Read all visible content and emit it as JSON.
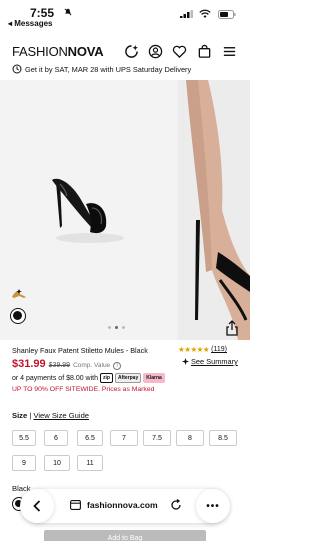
{
  "status_bar": {
    "time": "7:55",
    "back_app": "◂ Messages"
  },
  "header": {
    "logo_part1": "FASHION",
    "logo_part2": "NOVA",
    "icons": [
      "sparkle-search-icon",
      "account-icon",
      "heart-icon",
      "bag-icon",
      "menu-icon"
    ]
  },
  "delivery": {
    "text": "Get it by SAT, MAR 28 with UPS Saturday Delivery"
  },
  "gallery": {
    "dot_count": 3,
    "active_dot": 1
  },
  "product": {
    "title": "Shanley Faux Patent Stiletto Mules - Black",
    "rating_stars": "★★★★★",
    "review_count": "(119)",
    "see_summary": "See Summary",
    "price": "$31.99",
    "old_price": "$39.99",
    "comp_value": "Comp. Value",
    "installments": "or 4 payments of $8.00 with",
    "pay_badges": [
      "zip",
      "Afterpay",
      "Klarna"
    ],
    "promo": "UP TO 90% OFF SITEWIDE. Prices as Marked"
  },
  "size": {
    "label": "Size",
    "separator": "|",
    "guide": "View Size Guide",
    "options": [
      "5.5",
      "6",
      "6.5",
      "7",
      "7.5",
      "8",
      "8.5",
      "9",
      "10",
      "11"
    ]
  },
  "color": {
    "label": "Black"
  },
  "browser": {
    "url": "fashionnova.com",
    "more": "•••"
  },
  "cta": {
    "add_to_bag": "Add to Bag"
  },
  "colors": {
    "accent_red": "#c0152e",
    "star_gold": "#e0a000"
  }
}
